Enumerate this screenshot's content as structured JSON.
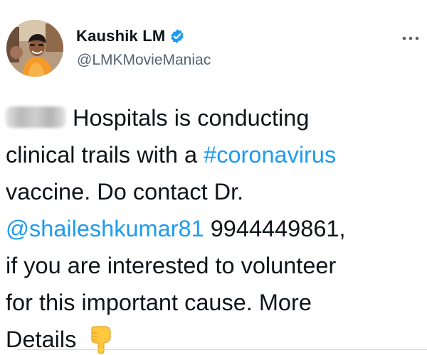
{
  "author": {
    "display_name": "Kaushik LM",
    "handle": "@LMKMovieManiac",
    "verified": true,
    "avatar_icon": "profile-photo"
  },
  "menu_icon": "more-horizontal-icon",
  "tweet": {
    "lines": [
      {
        "segments": [
          {
            "text": "Hospitals is conducting",
            "type": "text"
          }
        ]
      },
      {
        "segments": [
          {
            "text": "clinical trails with a ",
            "type": "text"
          },
          {
            "text": "#coronavirus",
            "type": "hashtag"
          }
        ]
      },
      {
        "segments": [
          {
            "text": "vaccine. Do contact Dr.",
            "type": "text"
          }
        ]
      },
      {
        "segments": [
          {
            "text": "@shaileshkumar81",
            "type": "mention"
          },
          {
            "text": " 9944449861,",
            "type": "text"
          }
        ]
      },
      {
        "segments": [
          {
            "text": "if you are interested to volunteer",
            "type": "text"
          }
        ]
      },
      {
        "segments": [
          {
            "text": "for this important cause. More",
            "type": "text"
          }
        ]
      },
      {
        "segments": [
          {
            "text": "Details",
            "type": "text"
          }
        ]
      }
    ],
    "redacted_prefix": true,
    "trailing_emoji": "backhand-index-pointing-down"
  },
  "colors": {
    "link": "#1d9bf0",
    "verified_badge": "#1d9bf0",
    "handle": "#536471",
    "text": "#0f1419",
    "emoji": "#ffc83d"
  }
}
